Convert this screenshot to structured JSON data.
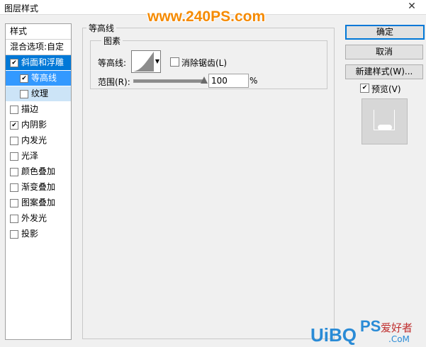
{
  "window": {
    "title": "图层样式",
    "close_glyph": "✕"
  },
  "watermark": "www.240PS.com",
  "sidebar": {
    "header": "样式",
    "blend_options": "混合选项:自定",
    "items": [
      {
        "label": "斜面和浮雕",
        "checked": true,
        "state": "selected-parent"
      },
      {
        "label": "等高线",
        "checked": true,
        "state": "selected"
      },
      {
        "label": "纹理",
        "checked": false,
        "state": "sub"
      },
      {
        "label": "描边",
        "checked": false
      },
      {
        "label": "内阴影",
        "checked": true
      },
      {
        "label": "内发光",
        "checked": false
      },
      {
        "label": "光泽",
        "checked": false
      },
      {
        "label": "颜色叠加",
        "checked": false
      },
      {
        "label": "渐变叠加",
        "checked": false
      },
      {
        "label": "图案叠加",
        "checked": false
      },
      {
        "label": "外发光",
        "checked": false
      },
      {
        "label": "投影",
        "checked": false
      }
    ]
  },
  "contour_panel": {
    "group_title": "等高线",
    "subgroup_title": "图素",
    "contour_label": "等高线:",
    "antialias_label": "消除锯齿(L)",
    "antialias_checked": false,
    "range_label": "范围(R):",
    "range_value": "100",
    "range_unit": "%",
    "range_fraction": 1.0
  },
  "buttons": {
    "ok": "确定",
    "cancel": "取消",
    "new_style": "新建样式(W)...",
    "preview_label": "预览(V)",
    "preview_checked": true
  },
  "corner_logo": {
    "ps": "PS",
    "site": "爱好者",
    "uibq": "UiBQ",
    "dotcom": ".CoM"
  }
}
